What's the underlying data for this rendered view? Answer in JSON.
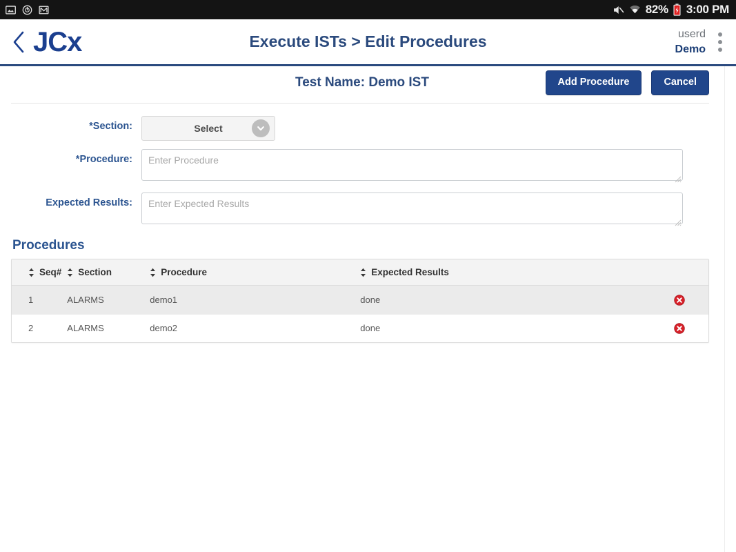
{
  "statusbar": {
    "left_icons": [
      "screenshot-icon",
      "clock-icon",
      "mail-icon"
    ],
    "mute_icon": "mute-icon",
    "wifi_icon": "wifi-icon",
    "battery_percent": "82%",
    "battery_icon": "battery-icon",
    "time": "3:00 PM"
  },
  "appbar": {
    "back_icon": "back-chevron-icon",
    "brand": "JCx",
    "title": "Execute ISTs > Edit Procedures",
    "user_name": "userd",
    "user_role": "Demo",
    "menu_icon": "kebab-menu-icon"
  },
  "toolbar": {
    "test_name": "Test Name: Demo IST",
    "add_procedure_label": "Add Procedure",
    "cancel_label": "Cancel"
  },
  "form": {
    "section_label": "*Section:",
    "section_value": "Select",
    "section_arrow_icon": "chevron-down-icon",
    "procedure_label": "*Procedure:",
    "procedure_value": "",
    "procedure_placeholder": "Enter Procedure",
    "expected_label": "Expected Results:",
    "expected_value": "",
    "expected_placeholder": "Enter Expected Results"
  },
  "procedures": {
    "heading": "Procedures",
    "columns": [
      {
        "key": "seq",
        "label": "Seq#",
        "sortable": true
      },
      {
        "key": "section",
        "label": "Section",
        "sortable": true
      },
      {
        "key": "procedure",
        "label": "Procedure",
        "sortable": true
      },
      {
        "key": "expected",
        "label": "Expected Results",
        "sortable": true
      }
    ],
    "rows": [
      {
        "seq": "1",
        "section": "ALARMS",
        "procedure": "demo1",
        "expected": "done",
        "delete_icon": "delete-circle-icon"
      },
      {
        "seq": "2",
        "section": "ALARMS",
        "procedure": "demo2",
        "expected": "done",
        "delete_icon": "delete-circle-icon"
      }
    ]
  },
  "colors": {
    "brand_navy": "#1b3f8f",
    "header_rule": "#2a4a7f",
    "button_blue": "#21468b",
    "label_blue": "#2b5490",
    "delete_red": "#d8212a",
    "statusbar_bg": "#141414",
    "row_alt_bg": "#ebebeb"
  }
}
